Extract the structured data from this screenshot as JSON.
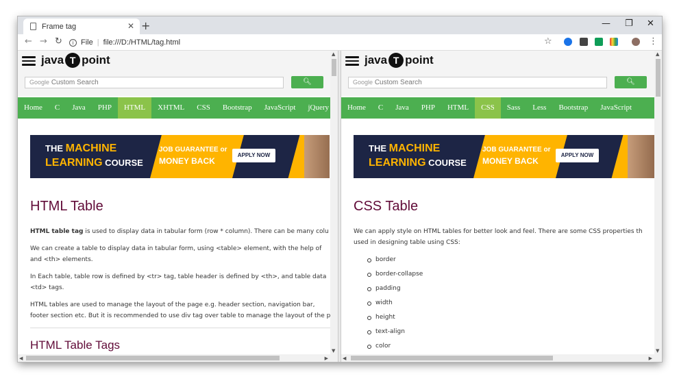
{
  "browser": {
    "tab_title": "Frame tag",
    "tab_close": "✕",
    "new_tab": "+",
    "address_scheme": "File",
    "address_url": "file:///D:/HTML/tag.html",
    "win_minimize": "—",
    "win_restore": "❐",
    "win_close": "✕"
  },
  "site": {
    "logo_left": "java",
    "logo_mid": "T",
    "logo_right": "point",
    "search_google": "Google",
    "search_placeholder": "Custom Search",
    "ad": {
      "line1_a": "THE ",
      "line1_b": "MACHINE",
      "line2_a": "LEARNING",
      "line2_b": " COURSE",
      "guarantee_a": "JOB GUARANTEE",
      "guarantee_b": " or",
      "money_back": "MONEY BACK",
      "apply": "APPLY NOW"
    }
  },
  "left": {
    "menu": [
      "Home",
      "C",
      "Java",
      "PHP",
      "HTML",
      "XHTML",
      "CSS",
      "Bootstrap",
      "JavaScript",
      "jQuery"
    ],
    "active_index": 4,
    "title": "HTML Table",
    "p1_bold": "HTML table tag",
    "p1_rest": " is used to display data in tabular form (row * column). There can be many colu",
    "p2_l1": "We can create a table to display data in tabular form, using <table> element, with the help of",
    "p2_l2": "and <th> elements.",
    "p3_l1": "In Each table, table row is defined by <tr> tag, table header is defined by <th>, and table data",
    "p3_l2": "<td> tags.",
    "p4_l1": "HTML tables are used to manage the layout of the page e.g. header section, navigation bar,",
    "p4_l2": "footer section etc. But it is recommended to use div tag over table to manage the layout of the p",
    "subtitle": "HTML Table Tags"
  },
  "right": {
    "menu": [
      "Home",
      "C",
      "Java",
      "PHP",
      "HTML",
      "CSS",
      "Sass",
      "Less",
      "Bootstrap",
      "JavaScript"
    ],
    "active_index": 5,
    "title": "CSS Table",
    "p1_l1": "We can apply style on HTML tables for better look and feel. There are some CSS properties th",
    "p1_l2": "used in designing table using CSS:",
    "properties": [
      "border",
      "border-collapse",
      "padding",
      "width",
      "height",
      "text-align",
      "color"
    ]
  },
  "colors": {
    "menu_green": "#4caf50",
    "menu_active": "#8bc34a",
    "heading": "#610b38",
    "ad_navy": "#1d2545",
    "ad_yellow": "#ffb400"
  }
}
